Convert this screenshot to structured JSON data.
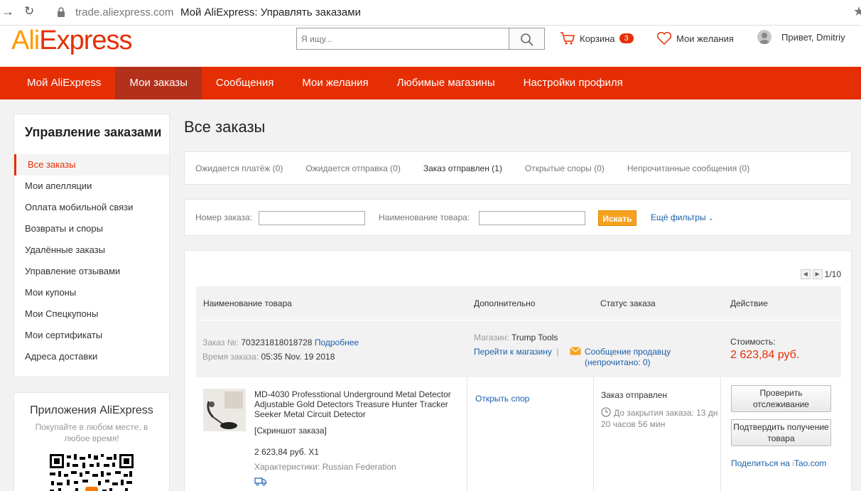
{
  "browser": {
    "url": "trade.aliexpress.com",
    "tab_title": "Мой AliExpress: Управлять заказами"
  },
  "header": {
    "logo_ali": "Ali",
    "logo_express": "Express",
    "search_placeholder": "Я ищу...",
    "cart_label": "Корзина",
    "cart_count": "3",
    "wishlist_label": "Мои желания",
    "greeting": "Привет, Dmitriy"
  },
  "nav": {
    "items": [
      "Мой AliExpress",
      "Мои заказы",
      "Сообщения",
      "Мои желания",
      "Любимые магазины",
      "Настройки профиля"
    ],
    "active": "Мои заказы"
  },
  "sidebar": {
    "title": "Управление заказами",
    "items": [
      "Все заказы",
      "Мои апелляции",
      "Оплата мобильной связи",
      "Возвраты и споры",
      "Удалённые заказы",
      "Управление отзывами",
      "Мои купоны",
      "Мои Спецкупоны",
      "Мои сертификаты",
      "Адреса доставки"
    ],
    "active": "Все заказы"
  },
  "apps": {
    "title": "Приложения AliExpress",
    "subtitle": "Покупайте в любом месте, в любое время!"
  },
  "main": {
    "title": "Все заказы",
    "tabs": [
      "Ожидается платёж (0)",
      "Ожидается отправка (0)",
      "Заказ отправлен (1)",
      "Открытые споры (0)",
      "Непрочитанные сообщения (0)"
    ],
    "active_tab": "Заказ отправлен (1)",
    "filters": {
      "order_no_label": "Номер заказа:",
      "product_label": "Наименование товара:",
      "search_button": "Искать",
      "more_filters": "Ещё фильтры"
    },
    "pager": "1/10",
    "table_headers": [
      "Наименование товара",
      "Дополнительно",
      "Статус заказа",
      "Действие"
    ],
    "order": {
      "number_label": "Заказ №:",
      "number": "703231818018728",
      "details_link": "Подробнее",
      "time_label": "Время заказа:",
      "time": "05:35 Nov. 19 2018",
      "store_label": "Магазин:",
      "store": "Trump Tools",
      "store_link": "Перейти к магазину",
      "message_link": "Сообщение продавцу",
      "unread": "(непрочитано: 0)",
      "cost_label": "Стоимость:",
      "cost": "2 623,84 руб.",
      "product_name": "MD-4030 Professtional Underground Metal Detector Adjustable Gold Detectors Treasure Hunter Tracker Seeker Metal Circuit Detector",
      "snapshot": "[Скриншот заказа]",
      "price_qty": "2 623,84 руб. X1",
      "specs": "Характеристики: Russian Federation",
      "dispute_link": "Открыть спор",
      "status": "Заказ отправлен",
      "closing": "До закрытия заказа: 13 дн 20 часов 56 мин",
      "track_button": "Проверить отслеживание",
      "confirm_button": "Подтвердить получение товара",
      "share_text": "Поделиться на",
      "share_brand_i": "i",
      "share_brand_rest": "Tao.com"
    }
  }
}
